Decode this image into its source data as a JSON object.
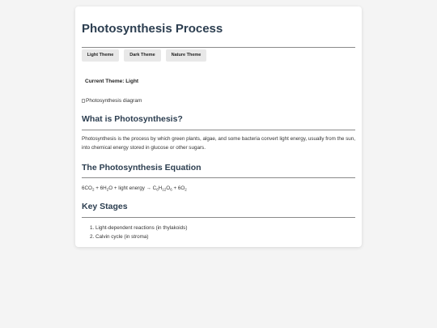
{
  "page": {
    "title": "Photosynthesis Process"
  },
  "theme_buttons": {
    "light": "Light Theme",
    "dark": "Dark Theme",
    "nature": "Nature Theme"
  },
  "current_theme": {
    "label": "Current Theme: Light"
  },
  "image": {
    "alt": "Photosynthesis diagram"
  },
  "what_is": {
    "heading": "What is Photosynthesis?",
    "text": "Photosynthesis is the process by which green plants, algae, and some bacteria convert light energy, usually from the sun, into chemical energy stored in glucose or other sugars."
  },
  "equation": {
    "heading": "The Photosynthesis Equation",
    "reactant1_coef": "6CO",
    "reactant1_sub": "2",
    "plus1": " + 6H",
    "reactant2_sub": "2",
    "reactant2_tail": "O + light energy → C",
    "product_c_sub": "6",
    "product_h": "H",
    "product_h_sub": "12",
    "product_o": "O",
    "product_o_sub": "6",
    "plus2": " + 6O",
    "product2_sub": "2"
  },
  "key_stages": {
    "heading": "Key Stages",
    "items": [
      "Light-dependent reactions (in thylakoids)",
      "Calvin cycle (in stroma)"
    ]
  },
  "colors": {
    "heading": "#2c3e50",
    "background": "#f4f4f4",
    "card": "#ffffff",
    "button": "#e8e8e8"
  }
}
